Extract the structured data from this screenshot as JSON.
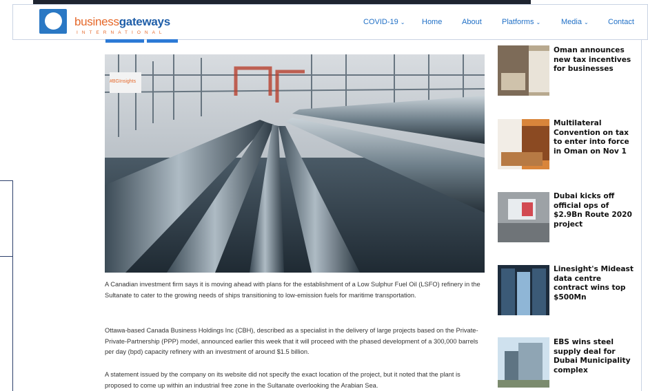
{
  "header": {
    "brand_main_1": "business",
    "brand_main_2": "gateways",
    "brand_sub": "INTERNATIONAL",
    "nav": [
      {
        "label": "COVID-19",
        "has_dropdown": true
      },
      {
        "label": "Home",
        "has_dropdown": false
      },
      {
        "label": "About",
        "has_dropdown": false
      },
      {
        "label": "Platforms",
        "has_dropdown": true
      },
      {
        "label": "Media",
        "has_dropdown": true
      },
      {
        "label": "Contact",
        "has_dropdown": false
      }
    ]
  },
  "article": {
    "image_badge": "#BGInsights",
    "paragraphs": [
      "A Canadian investment firm says it is moving ahead with plans for the establishment of a Low Sulphur Fuel Oil (LSFO) refinery in the Sultanate to cater to the growing needs of ships transitioning to low-emission fuels for maritime transportation.",
      "Ottawa-based Canada Business Holdings Inc (CBH), described as a specialist in the delivery of large projects based on the Private-Private-Partnership (PPP) model, announced earlier this week that it will proceed with the phased development of a 300,000 barrels per day (bpd) capacity refinery with an investment of around $1.5 billion.",
      "A statement issued by the company on its website did not specify the exact location of the project, but it noted that the plant is proposed to come up within an industrial free zone in the Sultanate overlooking the Arabian Sea."
    ]
  },
  "sidebar": {
    "items": [
      {
        "title": "Oman announces new tax incentives for businesses"
      },
      {
        "title": "Multilateral Convention on tax to enter into force in Oman on Nov 1"
      },
      {
        "title": "Dubai kicks off official ops of $2.9Bn Route 2020 project"
      },
      {
        "title": "Linesight's Mideast data centre contract wins top $500Mn"
      },
      {
        "title": "EBS wins steel supply deal for Dubai Municipality complex"
      }
    ]
  },
  "colors": {
    "nav_link": "#1f6fc6",
    "brand_orange": "#e5682a",
    "brand_blue": "#1f5ea8",
    "logo_blue": "#2a78c4"
  }
}
